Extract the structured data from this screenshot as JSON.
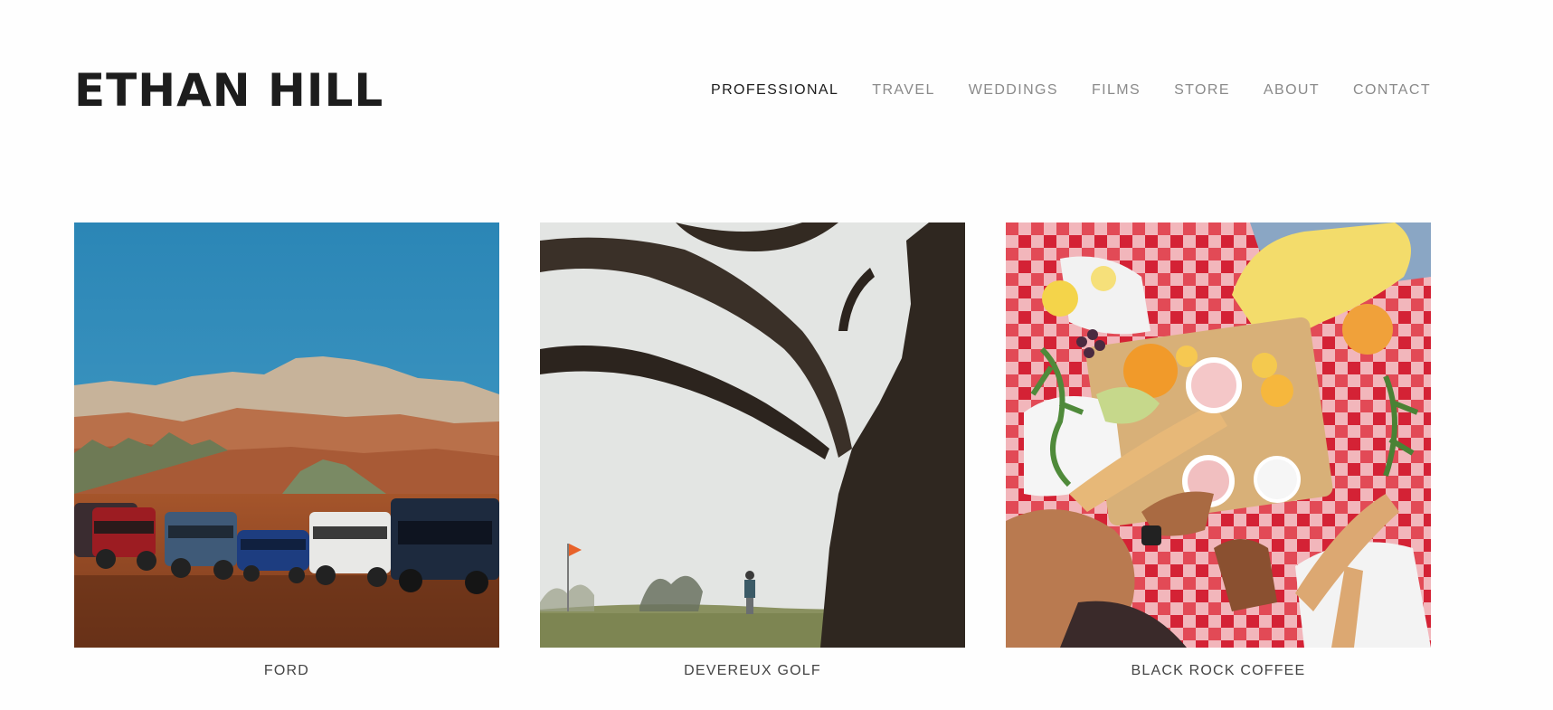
{
  "site": {
    "title": "ETHAN HILL"
  },
  "nav": [
    {
      "label": "PROFESSIONAL",
      "active": true
    },
    {
      "label": "TRAVEL",
      "active": false
    },
    {
      "label": "WEDDINGS",
      "active": false
    },
    {
      "label": "FILMS",
      "active": false
    },
    {
      "label": "STORE",
      "active": false
    },
    {
      "label": "ABOUT",
      "active": false
    },
    {
      "label": "CONTACT",
      "active": false
    }
  ],
  "gallery": [
    {
      "caption": "FORD",
      "image": "ford-vehicles-desert-image"
    },
    {
      "caption": "DEVEREUX GOLF",
      "image": "golf-tree-image"
    },
    {
      "caption": "BLACK ROCK COFFEE",
      "image": "picnic-image"
    }
  ]
}
